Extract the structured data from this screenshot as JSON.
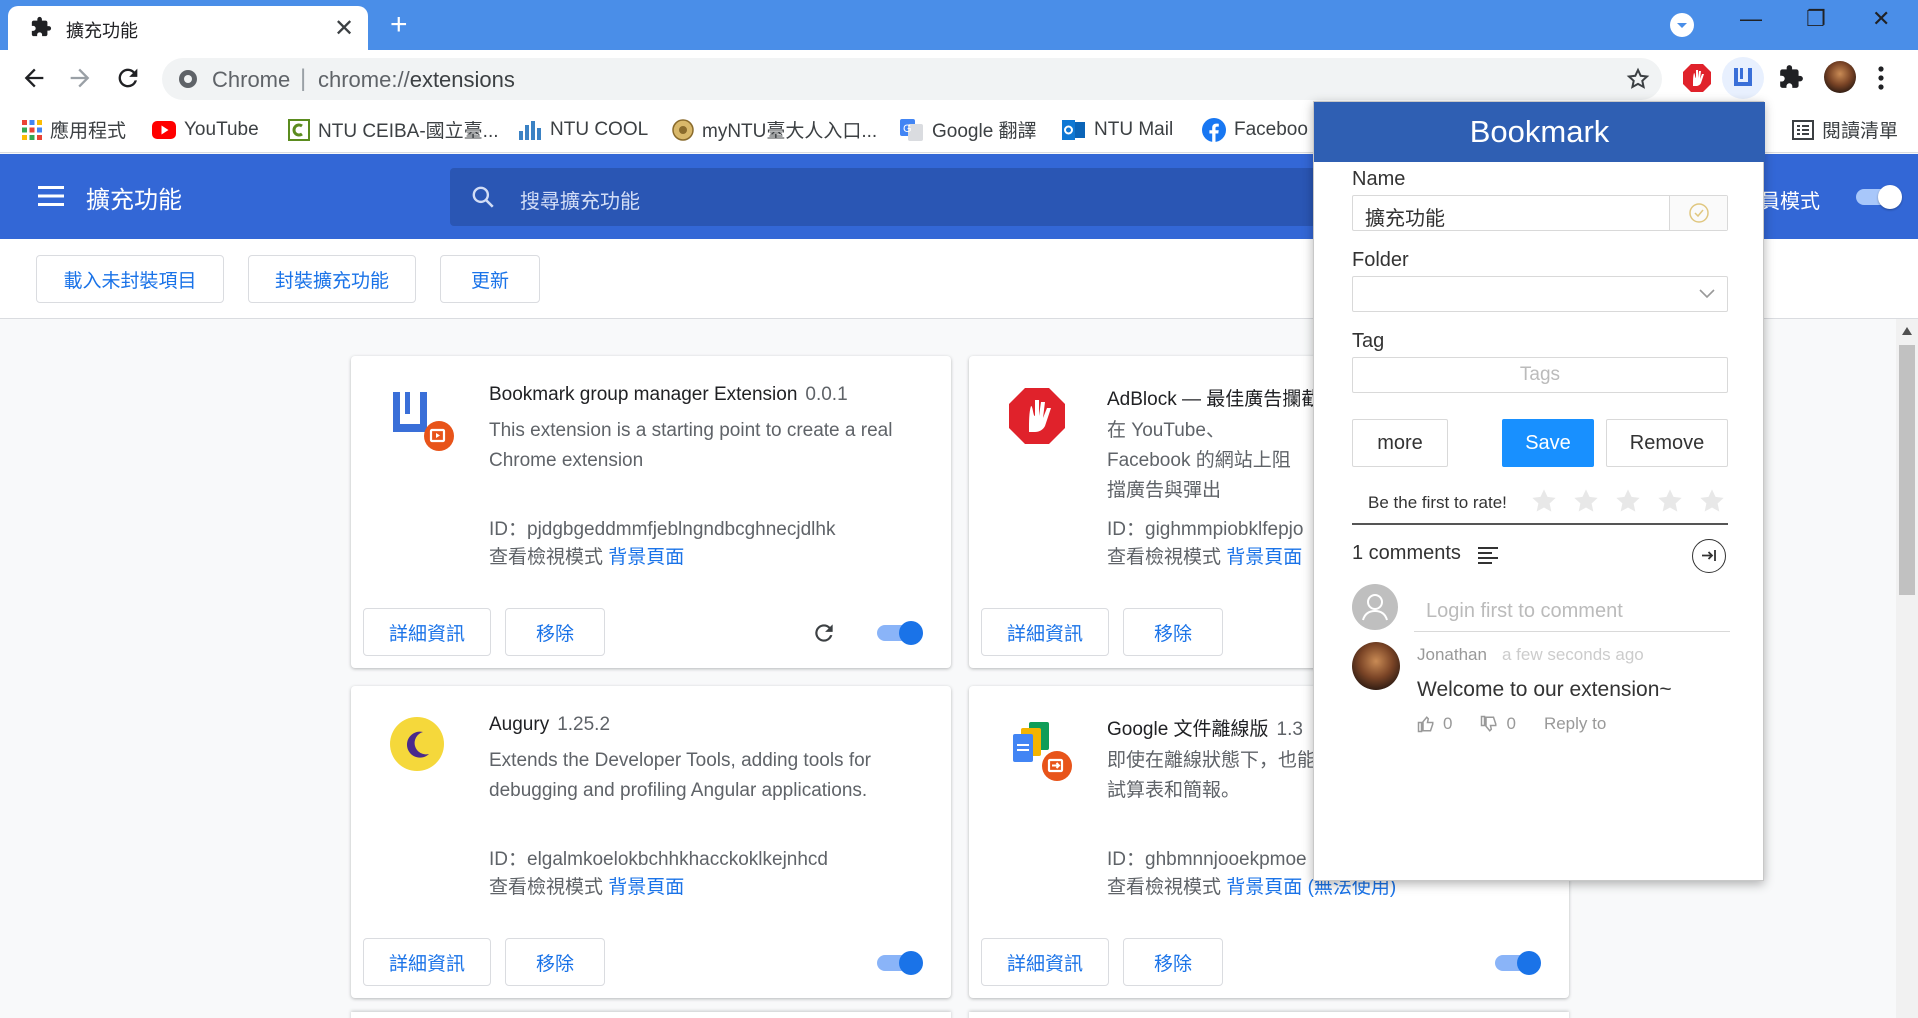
{
  "tab": {
    "title": "擴充功能",
    "close": "✕",
    "new_tab": "+"
  },
  "window": {
    "minimize": "—",
    "restore": "❐",
    "close": "✕"
  },
  "omnibox": {
    "site_label": "Chrome",
    "separator": "|",
    "url_scheme": "chrome://",
    "url_path": "extensions"
  },
  "bookmarks": [
    {
      "label": "應用程式",
      "icon": "apps-grid-icon"
    },
    {
      "label": "YouTube",
      "icon": "youtube-icon"
    },
    {
      "label": "NTU CEIBA-國立臺...",
      "icon": "ceiba-icon"
    },
    {
      "label": "NTU COOL",
      "icon": "ntu-cool-icon"
    },
    {
      "label": "myNTU臺大人入口...",
      "icon": "myntu-icon"
    },
    {
      "label": "Google 翻譯",
      "icon": "google-translate-icon"
    },
    {
      "label": "NTU Mail",
      "icon": "outlook-icon"
    },
    {
      "label": "Faceboo",
      "icon": "facebook-icon"
    },
    {
      "label": "閱讀清單",
      "icon": "reading-list-icon"
    }
  ],
  "header": {
    "title": "擴充功能",
    "search_placeholder": "搜尋擴充功能",
    "dev_mode_label": "人員模式",
    "dev_mode_on": true
  },
  "subbar": {
    "load_unpacked": "載入未封裝項目",
    "pack": "封裝擴充功能",
    "update": "更新"
  },
  "extensions": [
    {
      "name": "Bookmark group manager Extension",
      "version": "0.0.1",
      "desc": "This extension is a starting point to create a real Chrome extension",
      "id_text": "ID：pjdgbgeddmmfjeblngndbcghnecjdlhk",
      "views_label": "查看檢視模式",
      "views_link": "背景頁面",
      "details": "詳細資訊",
      "remove": "移除",
      "enabled": true
    },
    {
      "name": "AdBlock — 最佳廣告攔截",
      "version": "",
      "desc": "在 YouTube、Facebook 的網站上阻擋廣告與彈出",
      "id_text": "ID：gighmmpiobklfepjo",
      "views_label": "查看檢視模式",
      "views_link": "背景頁面",
      "details": "詳細資訊",
      "remove": "移除",
      "enabled": true
    },
    {
      "name": "Augury",
      "version": "1.25.2",
      "desc": "Extends the Developer Tools, adding tools for debugging and profiling Angular applications.",
      "id_text": "ID：elgalmkoelokbchhkhacckoklkejnhcd",
      "views_label": "查看檢視模式",
      "views_link": "背景頁面",
      "details": "詳細資訊",
      "remove": "移除",
      "enabled": true
    },
    {
      "name": "Google 文件離線版",
      "version": "1.3",
      "desc": "即使在離線狀態下，也能 試算表和簡報。",
      "id_text": "ID：ghbmnnjooekpmoe",
      "views_label": "查看檢視模式",
      "views_link": "背景頁面 (無法使用)",
      "details": "詳細資訊",
      "remove": "移除",
      "enabled": true
    }
  ],
  "popup": {
    "title": "Bookmark",
    "name_label": "Name",
    "name_value": "擴充功能",
    "folder_label": "Folder",
    "tag_label": "Tag",
    "tag_placeholder": "Tags",
    "more": "more",
    "save": "Save",
    "remove": "Remove",
    "rate_text": "Be the first to rate!",
    "rating": 0,
    "rating_max": 5,
    "comments_count": "1 comments",
    "login_placeholder": "Login first to comment",
    "comment": {
      "author": "Jonathan",
      "time": "a few seconds ago",
      "text": "Welcome to our extension~",
      "likes": "0",
      "dislikes": "0",
      "reply": "Reply to"
    },
    "colors": {
      "header": "#2f5fb3",
      "save": "#1890ff"
    }
  }
}
